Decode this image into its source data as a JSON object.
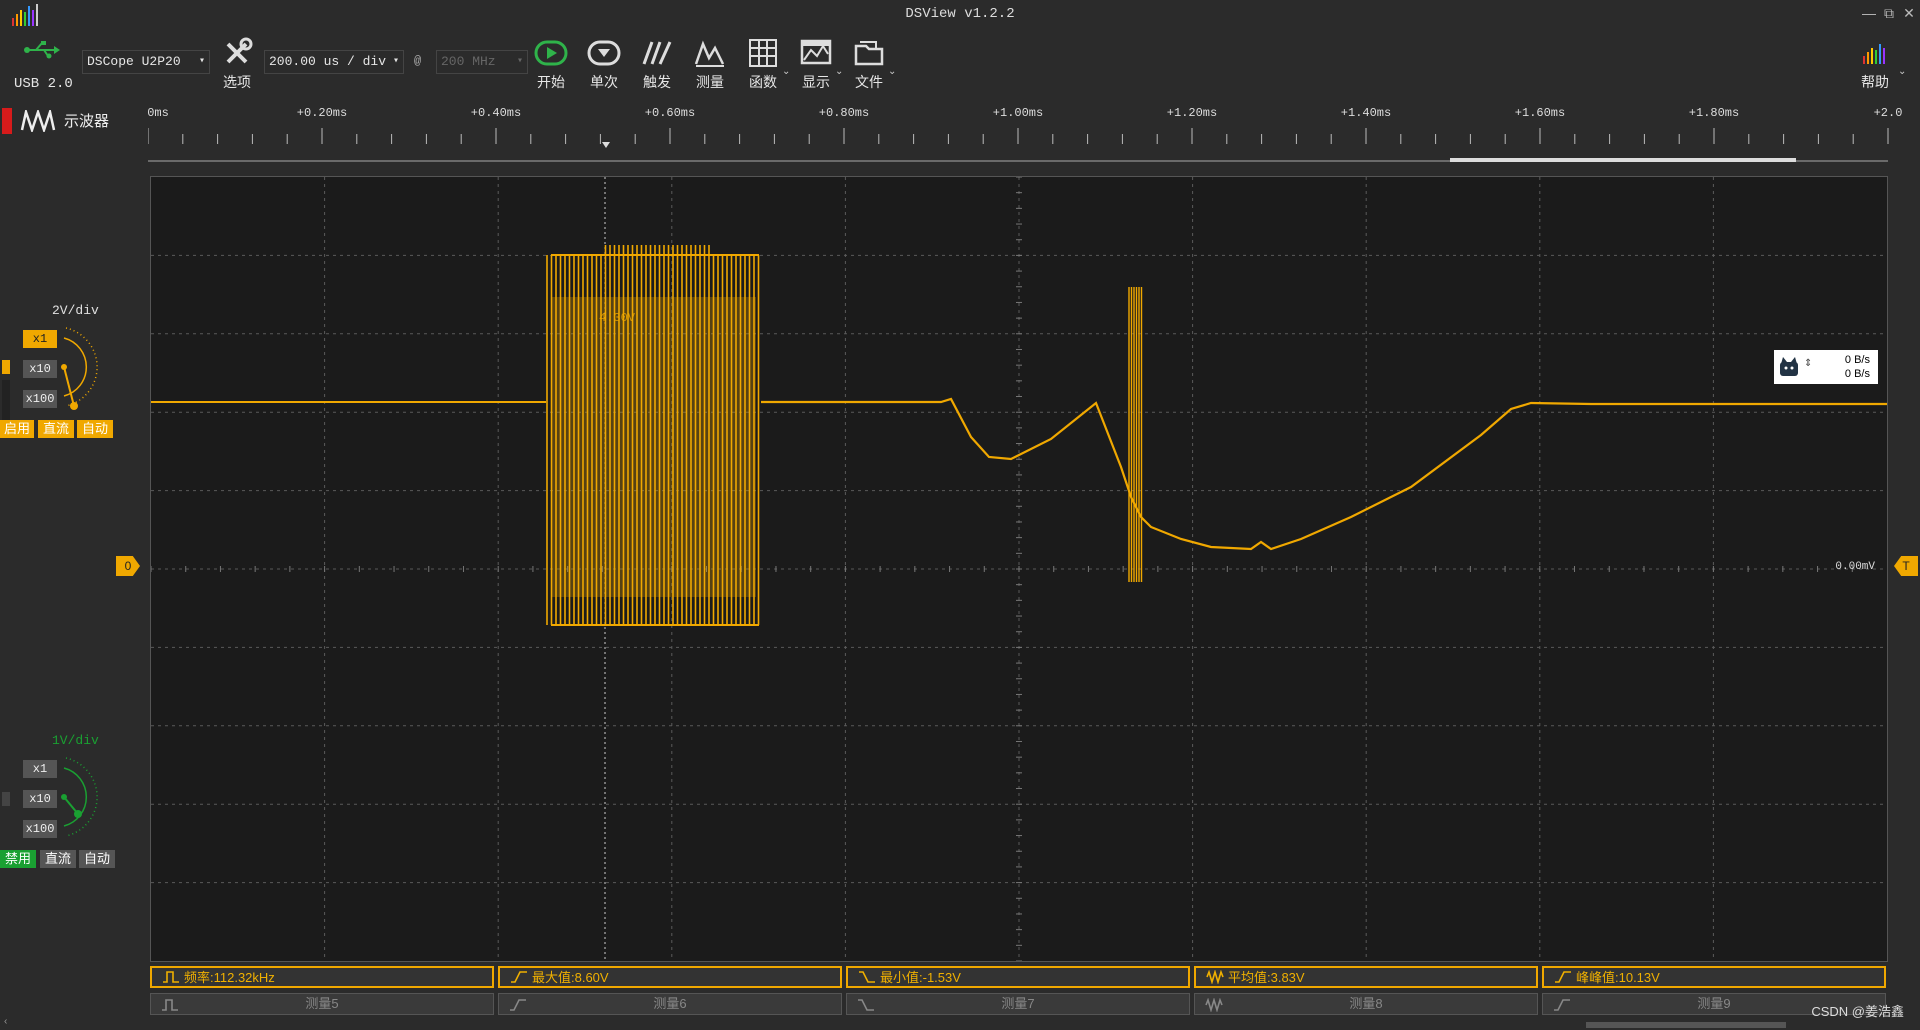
{
  "window": {
    "title": "DSView v1.2.2"
  },
  "toolbar": {
    "usb_label": "USB 2.0",
    "device": "DSCope U2P20",
    "options_label": "选项",
    "timebase": "200.00 us / div",
    "at_symbol": "@",
    "samplerate": "200 MHz",
    "buttons": [
      {
        "label": "开始",
        "icon": "play-icon"
      },
      {
        "label": "单次",
        "icon": "single-icon"
      },
      {
        "label": "触发",
        "icon": "trigger-icon"
      },
      {
        "label": "测量",
        "icon": "measure-icon"
      },
      {
        "label": "函数",
        "icon": "math-icon"
      },
      {
        "label": "显示",
        "icon": "display-icon"
      },
      {
        "label": "文件",
        "icon": "file-icon"
      }
    ],
    "help_label": "帮助"
  },
  "mode": {
    "label": "示波器"
  },
  "ruler": {
    "labels": [
      "0ms",
      "+0.20ms",
      "+0.40ms",
      "+0.60ms",
      "+0.80ms",
      "+1.00ms",
      "+1.20ms",
      "+1.40ms",
      "+1.60ms",
      "+1.80ms",
      "+2.0"
    ]
  },
  "channels": [
    {
      "id": "0",
      "vdiv": "2V/div",
      "color": "#f0a800",
      "probes": [
        "x1",
        "x10",
        "x100"
      ],
      "active_probe": "x1",
      "modes": [
        "启用",
        "直流",
        "自动"
      ]
    },
    {
      "id": "1",
      "vdiv": "1V/div",
      "color": "#1aa032",
      "probes": [
        "x1",
        "x10",
        "x100"
      ],
      "active_probe": "x10",
      "modes": [
        "禁用",
        "直流",
        "自动"
      ]
    }
  ],
  "scope": {
    "cursor_value": "4.30V",
    "zero_label": "0.00mV",
    "ch0_marker": "0",
    "trigger_marker": "T",
    "rate_top": "0 B/s",
    "rate_bottom": "0 B/s"
  },
  "measurements": {
    "active": [
      {
        "label": "频率:112.32kHz",
        "icon": "pulse-icon"
      },
      {
        "label": "最大值:8.60V",
        "icon": "rise-icon"
      },
      {
        "label": "最小值:-1.53V",
        "icon": "fall-icon"
      },
      {
        "label": "平均值:3.83V",
        "icon": "wave-icon"
      },
      {
        "label": "峰峰值:10.13V",
        "icon": "rise-icon"
      }
    ],
    "inactive": [
      "测量5",
      "测量6",
      "测量7",
      "测量8",
      "测量9"
    ]
  },
  "watermark": "CSDN @姜浩鑫",
  "colors": {
    "accent": "#f0a800",
    "green": "#1aa032",
    "bg": "#2b2b2b",
    "scope_bg": "#1b1b1b"
  }
}
